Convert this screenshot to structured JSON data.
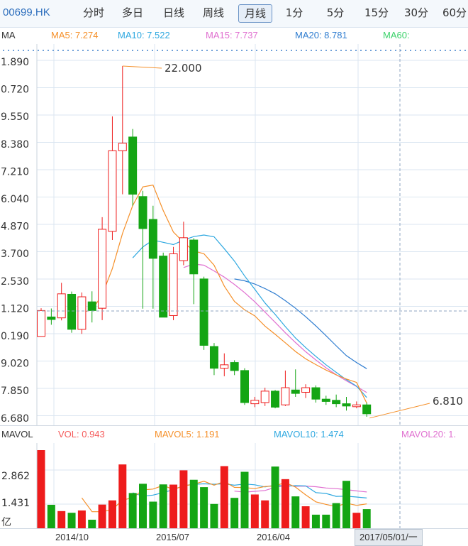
{
  "toolbar": {
    "symbol": "00699.HK",
    "periods": [
      "分时",
      "多日",
      "日线",
      "周线",
      "月线",
      "1分",
      "5分",
      "15分",
      "30分",
      "60分"
    ],
    "active_period": "月线"
  },
  "ma_legend": {
    "title": "MA",
    "items": [
      {
        "label": "MA5: 7.274",
        "color": "#f5902a"
      },
      {
        "label": "MA10: 7.522",
        "color": "#2ea8e0"
      },
      {
        "label": "MA15: 7.737",
        "color": "#e06fd0"
      },
      {
        "label": "MA20: 8.781",
        "color": "#2f7dd0"
      },
      {
        "label": "MA60:",
        "color": "#3bd26a"
      }
    ]
  },
  "price_axis": [
    "1.890",
    "0.720",
    "9.550",
    "8.380",
    "7.210",
    "6.040",
    "4.870",
    "3.700",
    "2.530",
    "1.120",
    "0.190",
    "9.020",
    "7.850",
    "6.680"
  ],
  "annotations": {
    "high": "22.000",
    "last": "6.810"
  },
  "vol_legend": {
    "title": "MAVOL",
    "items": [
      {
        "label": "VOL: 0.943",
        "color": "#f55a5a"
      },
      {
        "label": "MAVOL5: 1.191",
        "color": "#f5902a"
      },
      {
        "label": "MAVOL10: 1.474",
        "color": "#2ea8e0"
      },
      {
        "label": "MAVOL20: 1.",
        "color": "#e06fd0"
      }
    ]
  },
  "vol_axis": [
    "2.862",
    "1.431",
    "亿"
  ],
  "dates": [
    "2014/10",
    "2015/07",
    "2016/04"
  ],
  "cursor_date": "2017/05/01/一",
  "colors": {
    "up": "#ee1c1c",
    "down": "#14a514",
    "grid": "#dbe6f1",
    "accent": "#2e6fbd"
  },
  "chart_data": {
    "type": "candlestick",
    "candles": [
      {
        "o": 10.19,
        "c": 11.32,
        "h": 11.42,
        "l": 10.19,
        "v": 3.75
      },
      {
        "o": 11.04,
        "c": 10.93,
        "h": 11.41,
        "l": 10.7,
        "v": 1.15
      },
      {
        "o": 11.0,
        "c": 12.05,
        "h": 12.53,
        "l": 10.89,
        "v": 0.85
      },
      {
        "o": 12.03,
        "c": 10.5,
        "h": 12.15,
        "l": 10.35,
        "v": 0.77
      },
      {
        "o": 10.5,
        "c": 11.92,
        "h": 12.11,
        "l": 10.3,
        "v": 0.88
      },
      {
        "o": 11.7,
        "c": 11.32,
        "h": 12.16,
        "l": 10.8,
        "v": 0.44
      },
      {
        "o": 11.42,
        "c": 14.87,
        "h": 15.4,
        "l": 10.9,
        "v": 1.16
      },
      {
        "o": 14.78,
        "c": 18.3,
        "h": 19.8,
        "l": 14.4,
        "v": 1.36
      },
      {
        "o": 18.3,
        "c": 18.63,
        "h": 22.0,
        "l": 16.4,
        "v": 3.07
      },
      {
        "o": 18.9,
        "c": 16.4,
        "h": 19.25,
        "l": 15.9,
        "v": 1.71
      },
      {
        "o": 16.3,
        "c": 14.9,
        "h": 16.55,
        "l": 11.4,
        "v": 2.15
      },
      {
        "o": 15.3,
        "c": 13.6,
        "h": 15.9,
        "l": 11.4,
        "v": 1.3
      },
      {
        "o": 13.7,
        "c": 11.03,
        "h": 13.85,
        "l": 11.03,
        "v": 2.12
      },
      {
        "o": 11.1,
        "c": 13.8,
        "h": 14.1,
        "l": 10.9,
        "v": 2.11
      },
      {
        "o": 13.5,
        "c": 14.5,
        "h": 15.2,
        "l": 13.3,
        "v": 2.79
      },
      {
        "o": 14.4,
        "c": 12.92,
        "h": 14.48,
        "l": 11.6,
        "v": 2.34
      },
      {
        "o": 12.7,
        "c": 9.8,
        "h": 12.8,
        "l": 9.6,
        "v": 1.99
      },
      {
        "o": 9.75,
        "c": 8.8,
        "h": 9.9,
        "l": 8.5,
        "v": 1.19
      },
      {
        "o": 8.8,
        "c": 8.95,
        "h": 9.45,
        "l": 8.45,
        "v": 2.99
      },
      {
        "o": 9.05,
        "c": 8.7,
        "h": 9.15,
        "l": 8.5,
        "v": 1.48
      },
      {
        "o": 8.7,
        "c": 7.3,
        "h": 8.8,
        "l": 7.2,
        "v": 2.72
      },
      {
        "o": 7.25,
        "c": 7.4,
        "h": 7.55,
        "l": 7.1,
        "v": 1.64
      },
      {
        "o": 7.3,
        "c": 7.8,
        "h": 7.95,
        "l": 7.15,
        "v": 1.36
      },
      {
        "o": 7.8,
        "c": 7.1,
        "h": 7.85,
        "l": 7.05,
        "v": 2.97
      },
      {
        "o": 7.2,
        "c": 7.95,
        "h": 8.7,
        "l": 7.15,
        "v": 2.37
      },
      {
        "o": 7.85,
        "c": 7.7,
        "h": 8.75,
        "l": 7.55,
        "v": 1.55
      },
      {
        "o": 7.75,
        "c": 7.95,
        "h": 8.1,
        "l": 7.5,
        "v": 1.08
      },
      {
        "o": 7.95,
        "c": 7.45,
        "h": 8.05,
        "l": 7.3,
        "v": 0.68
      },
      {
        "o": 7.45,
        "c": 7.35,
        "h": 7.6,
        "l": 7.2,
        "v": 0.68
      },
      {
        "o": 7.4,
        "c": 7.25,
        "h": 7.65,
        "l": 7.1,
        "v": 1.23
      },
      {
        "o": 7.25,
        "c": 7.15,
        "h": 7.55,
        "l": 6.95,
        "v": 2.29
      },
      {
        "o": 7.12,
        "c": 7.2,
        "h": 7.35,
        "l": 7.05,
        "v": 0.77
      },
      {
        "o": 7.2,
        "c": 6.81,
        "h": 7.3,
        "l": 6.68,
        "v": 0.943
      }
    ],
    "ma5": [
      null,
      null,
      null,
      null,
      11.24,
      11.35,
      12.0,
      13.15,
      14.69,
      15.91,
      16.72,
      16.8,
      15.69,
      14.75,
      14.3,
      13.92,
      13.8,
      13.3,
      12.39,
      11.72,
      11.35,
      11.09,
      10.64,
      10.28,
      9.91,
      9.53,
      9.21,
      8.96,
      8.72,
      8.51,
      8.33,
      8.18,
      7.274
    ],
    "ma10": [
      null,
      null,
      null,
      null,
      null,
      null,
      null,
      null,
      null,
      13.62,
      14.1,
      14.4,
      14.3,
      14.2,
      14.4,
      14.55,
      14.62,
      14.54,
      14.02,
      13.48,
      12.83,
      12.25,
      11.65,
      11.15,
      10.62,
      10.12,
      9.7,
      9.32,
      8.95,
      8.62,
      8.3,
      8.02,
      7.522
    ],
    "ma15": [
      null,
      null,
      null,
      null,
      null,
      null,
      null,
      null,
      null,
      null,
      null,
      null,
      null,
      null,
      13.2,
      13.35,
      13.3,
      13.05,
      12.78,
      12.46,
      12.1,
      11.7,
      11.25,
      10.8,
      10.35,
      9.92,
      9.52,
      9.16,
      8.82,
      8.52,
      8.25,
      8.0,
      7.737
    ],
    "ma20": [
      null,
      null,
      null,
      null,
      null,
      null,
      null,
      null,
      null,
      null,
      null,
      null,
      null,
      null,
      null,
      null,
      null,
      null,
      null,
      12.7,
      12.62,
      12.48,
      12.28,
      12.05,
      11.75,
      11.42,
      11.05,
      10.65,
      10.22,
      9.78,
      9.35,
      9.05,
      8.781
    ],
    "mavol5": [
      null,
      null,
      null,
      null,
      1.48,
      0.82,
      0.82,
      0.92,
      1.38,
      1.48,
      1.86,
      1.9,
      2.07,
      1.88,
      2.05,
      2.13,
      2.27,
      2.08,
      2.26,
      1.98,
      1.97,
      1.92,
      2.02,
      2.05,
      2.21,
      1.99,
      1.62,
      1.29,
      1.17,
      1.06,
      1.23,
      1.12,
      1.191
    ],
    "mavol10": [
      null,
      null,
      null,
      null,
      null,
      null,
      null,
      null,
      null,
      1.72,
      1.56,
      1.61,
      1.73,
      1.87,
      2.06,
      2.12,
      2.15,
      2.13,
      2.15,
      2.08,
      2.14,
      2.1,
      2.0,
      2.08,
      2.03,
      2.06,
      2.05,
      1.73,
      1.69,
      1.55,
      1.56,
      1.52,
      1.474
    ],
    "mavol20": [
      null,
      null,
      null,
      null,
      null,
      null,
      null,
      null,
      null,
      null,
      null,
      null,
      null,
      null,
      null,
      null,
      null,
      null,
      null,
      1.8,
      1.75,
      1.79,
      1.83,
      1.98,
      2.07,
      2.03,
      2.04,
      2.01,
      1.95,
      1.92,
      1.87,
      1.81,
      1.76
    ]
  }
}
